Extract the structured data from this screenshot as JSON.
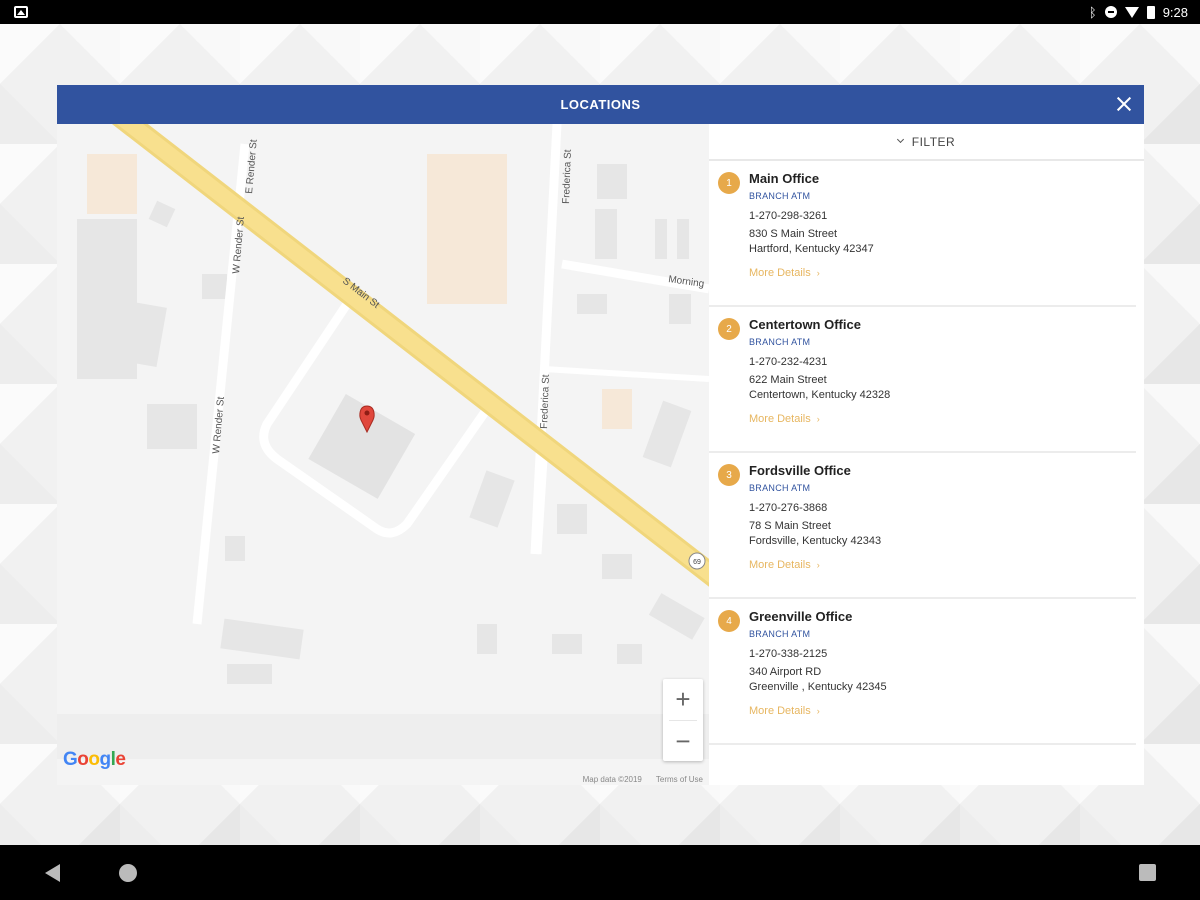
{
  "status_bar": {
    "time": "9:28",
    "icons": [
      "image-icon",
      "bluetooth-icon",
      "do-not-disturb-icon",
      "wifi-icon",
      "battery-icon"
    ]
  },
  "panel": {
    "title": "LOCATIONS",
    "close_icon": "close-icon"
  },
  "map": {
    "road_labels": [
      "S Main St",
      "W Render St",
      "E Render St",
      "W Render St",
      "Frederica St",
      "Frederica St",
      "Morning"
    ],
    "shield_label": "69",
    "google_logo": [
      "G",
      "o",
      "o",
      "g",
      "l",
      "e"
    ],
    "attribution": "Map data ©2019",
    "terms": "Terms of Use",
    "zoom_in": "+",
    "zoom_out": "−",
    "marker_icon": "map-pin-icon"
  },
  "filter": {
    "label": "FILTER",
    "icon": "chevron-down-icon"
  },
  "locations": [
    {
      "num": "1",
      "name": "Main Office",
      "tags": "BRANCH  ATM",
      "phone": "1-270-298-3261",
      "address1": "830 S Main Street",
      "address2": "Hartford, Kentucky 42347",
      "more": "More Details"
    },
    {
      "num": "2",
      "name": "Centertown Office",
      "tags": "BRANCH  ATM",
      "phone": "1-270-232-4231",
      "address1": "622 Main Street",
      "address2": "Centertown, Kentucky 42328",
      "more": "More Details"
    },
    {
      "num": "3",
      "name": "Fordsville Office",
      "tags": "BRANCH  ATM",
      "phone": "1-270-276-3868",
      "address1": "78 S Main Street",
      "address2": "Fordsville, Kentucky 42343",
      "more": "More Details"
    },
    {
      "num": "4",
      "name": "Greenville Office",
      "tags": "BRANCH  ATM",
      "phone": "1-270-338-2125",
      "address1": "340 Airport RD",
      "address2": "Greenville , Kentucky 42345",
      "more": "More Details"
    }
  ],
  "colors": {
    "header": "#31539f",
    "accent": "#e7a94a",
    "tag": "#31539f"
  },
  "nav": {
    "back_icon": "back-triangle-icon",
    "home_icon": "home-circle-icon",
    "recents_icon": "recents-square-icon"
  }
}
